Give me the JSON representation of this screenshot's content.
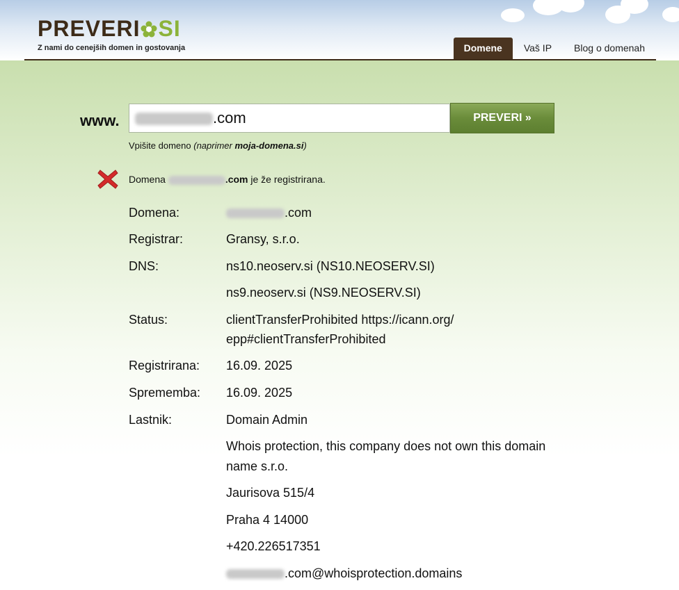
{
  "logo": {
    "text": "PREVERI",
    "suffix": "SI",
    "tagline": "Z nami do cenejših domen in gostovanja"
  },
  "nav": {
    "items": [
      "Domene",
      "Vaš IP",
      "Blog o domenah"
    ],
    "active": "Domene"
  },
  "search": {
    "prefix": "www.",
    "value_suffix": ".com",
    "button": "PREVERI »"
  },
  "hint": {
    "text": "Vpišite domeno ",
    "example_prefix": "(naprimer ",
    "example": "moja-domena.si",
    "example_suffix": ")"
  },
  "result": {
    "icon": "red-x-icon",
    "prefix": "Domena ",
    "domain_suffix": ".com",
    "suffix": " je že registrirana."
  },
  "details": {
    "domena_label": "Domena:",
    "domena_value": ".com",
    "registrar_label": "Registrar:",
    "registrar_value": "Gransy, s.r.o.",
    "dns_label": "DNS:",
    "dns_1": "ns10.neoserv.si (NS10.NEOSERV.SI)",
    "dns_2": "ns9.neoserv.si (NS9.NEOSERV.SI)",
    "status_label": "Status:",
    "status_value_1": "clientTransferProhibited https://icann.org/",
    "status_value_2": "epp#clientTransferProhibited",
    "registrirana_label": "Registrirana:",
    "registrirana_value": "16.09. 2025",
    "sprememba_label": "Sprememba:",
    "sprememba_value": "16.09. 2025",
    "lastnik_label": "Lastnik:",
    "lastnik_1": "Domain Admin",
    "lastnik_2a": "Whois protection, this company does not own this domain",
    "lastnik_2b": "name s.r.o.",
    "lastnik_3": "Jaurisova 515/4",
    "lastnik_4": "Praha 4 14000",
    "lastnik_5": "+420.226517351",
    "lastnik_6_suffix": ".com@whoisprotection.domains"
  },
  "colors": {
    "brand_brown": "#3d2b18",
    "brand_green": "#8cb33a",
    "button_green": "#6a8c3a",
    "error_red": "#d42a2a"
  }
}
